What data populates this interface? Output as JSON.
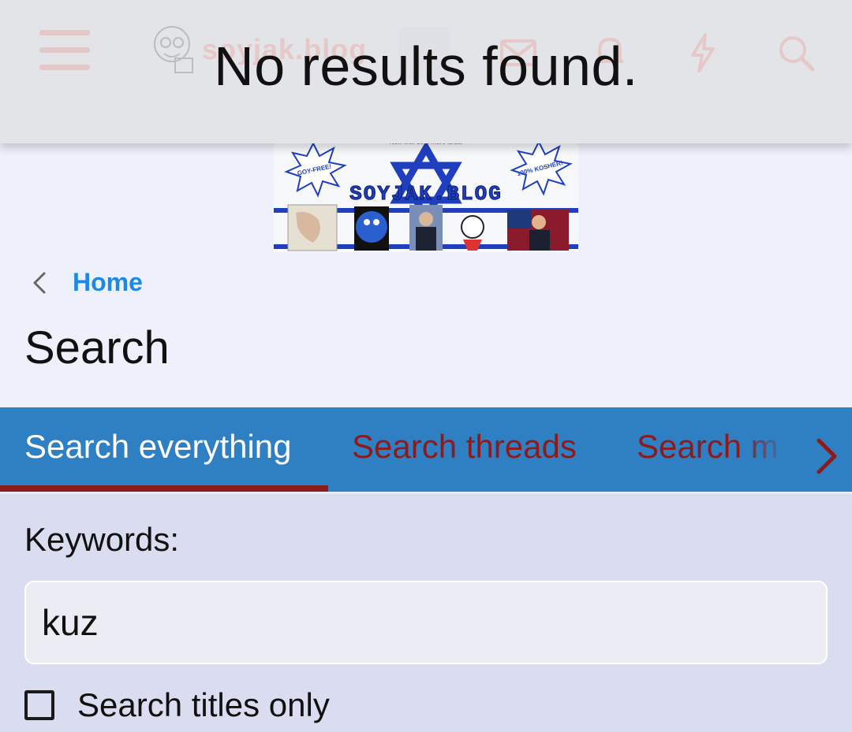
{
  "header": {
    "site_name": "soyjak.blog",
    "icons": [
      "menu-icon",
      "logo-icon",
      "avatar-icon",
      "mail-icon",
      "bell-icon",
      "bolt-icon",
      "search-icon"
    ]
  },
  "toast": {
    "message": "No results found."
  },
  "banner": {
    "top_text": "Now with 50% more Israel",
    "badge_left": "GOY-FREE!",
    "badge_right": "100% KOSHER!",
    "title": "SOYJAK.BLOG"
  },
  "breadcrumb": {
    "home_label": "Home"
  },
  "page": {
    "title": "Search"
  },
  "tabs": {
    "items": [
      "Search everything",
      "Search threads",
      "Search m"
    ]
  },
  "form": {
    "keywords_label": "Keywords:",
    "keywords_value": "kuz",
    "titles_only_label": "Search titles only",
    "titles_only_checked": false
  },
  "colors": {
    "accent_blue": "#2f7fc3",
    "link_blue": "#1e88e5",
    "tab_inactive": "#8e1b1b",
    "active_bar": "#8b1a1a"
  }
}
